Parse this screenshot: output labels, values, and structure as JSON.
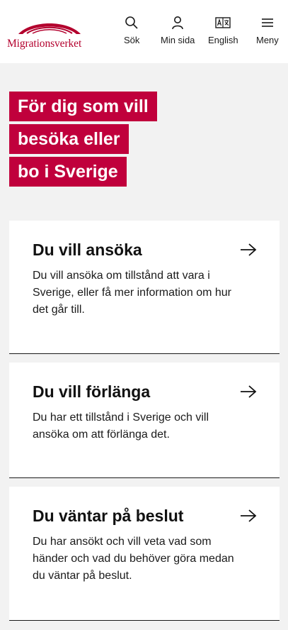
{
  "header": {
    "logo_text": "Migrationsverket",
    "nav": [
      {
        "label": "Sök",
        "icon": "search-icon"
      },
      {
        "label": "Min sida",
        "icon": "user-icon"
      },
      {
        "label": "English",
        "icon": "translate-icon"
      },
      {
        "label": "Meny",
        "icon": "menu-icon"
      }
    ]
  },
  "hero": {
    "lines": [
      "För dig som vill",
      "besöka eller",
      "bo i Sverige"
    ]
  },
  "cards": [
    {
      "title": "Du vill ansöka",
      "description": "Du vill ansöka om tillstånd att vara i Sverige, eller få mer information om hur det går till."
    },
    {
      "title": "Du vill förlänga",
      "description": "Du har ett tillstånd i Sverige och vill ansöka om att förlänga det."
    },
    {
      "title": "Du väntar på beslut",
      "description": "Du har ansökt och vill veta vad som händer och vad du behöver göra medan du väntar på beslut."
    }
  ],
  "colors": {
    "brand": "#c0003c",
    "logo": "#b3002d",
    "background": "#f2f2f2"
  }
}
